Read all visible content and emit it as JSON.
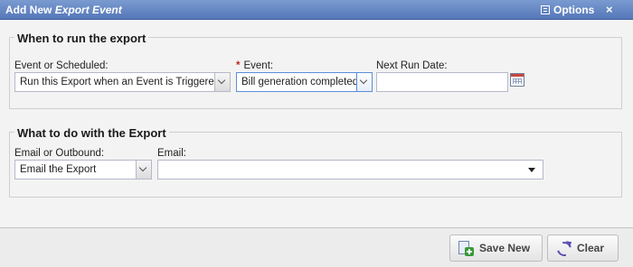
{
  "window": {
    "title_prefix": "Add New",
    "title_emphasis": "Export Event",
    "options_label": "Options",
    "close_glyph": "×"
  },
  "section_when": {
    "title": "When to run the export",
    "event_or_scheduled": {
      "label": "Event or Scheduled:",
      "value": "Run this Export when an Event is Triggered"
    },
    "event": {
      "required_mark": "*",
      "label": "Event:",
      "value": "Bill generation completed"
    },
    "next_run_date": {
      "label": "Next Run Date:",
      "value": ""
    }
  },
  "section_what": {
    "title": "What to do with the Export",
    "email_or_outbound": {
      "label": "Email or Outbound:",
      "value": "Email the Export"
    },
    "email": {
      "label": "Email:",
      "value": ""
    }
  },
  "footer": {
    "save_new_label": "Save New",
    "clear_label": "Clear"
  },
  "colors": {
    "titlebar": "#5f82c0",
    "required": "#c0261f",
    "focus_border": "#5b8ed7"
  },
  "icons": {
    "options": "list-icon",
    "close": "close-icon",
    "calendar": "calendar-icon",
    "save_new": "add-document-icon",
    "clear": "refresh-icon"
  }
}
